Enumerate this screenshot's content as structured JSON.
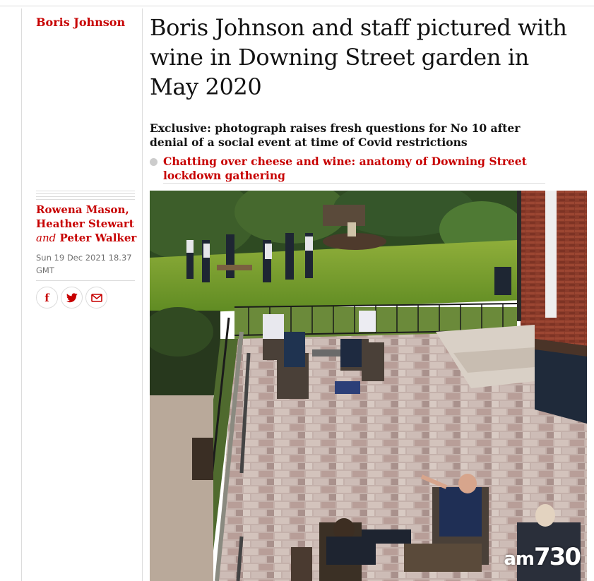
{
  "section": {
    "label": "Boris Johnson"
  },
  "article": {
    "headline": "Boris Johnson and staff pictured with wine in Downing Street garden in May 2020",
    "standfirst": "Exclusive: photograph raises fresh questions for No 10 after denial of a social event at time of Covid restrictions",
    "related_link": "Chatting over cheese and wine: anatomy of Downing Street lockdown gathering"
  },
  "byline": {
    "author1": "Rowena Mason,",
    "author2": "Heather Stewart",
    "conjunction": "and",
    "author3": "Peter Walker",
    "date": "Sun 19 Dec 2021 18.37 GMT"
  },
  "share": {
    "icons": [
      "facebook-icon",
      "twitter-icon",
      "email-icon"
    ]
  },
  "photo": {
    "watermark_am": "am",
    "watermark_num": "730"
  },
  "colors": {
    "accent": "#c70000",
    "text": "#121212",
    "meta": "#707070",
    "rule": "#dcdcdc"
  }
}
